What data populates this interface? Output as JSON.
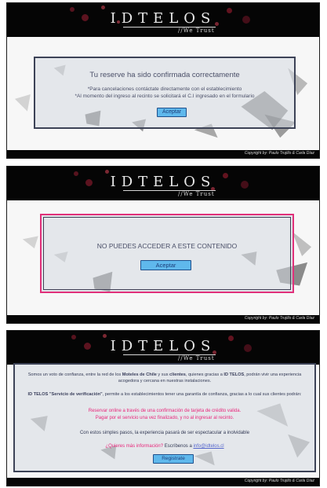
{
  "brand": {
    "logo": "IDTELOS",
    "slogan": "//We Trust"
  },
  "footer": {
    "copyright": "Copyright by: Paulo Trujillo & Carla Díaz"
  },
  "panel1": {
    "title": "Tu reserve ha sido confirmada correctamente",
    "line1": "*Para cancelaciones contáctate directamente con el establecimiento",
    "line2": "*Al momento del ingreso al recinto se solicitará el C.I ingresado en el formulario",
    "button": "Aceptar"
  },
  "panel2": {
    "title": "NO PUEDES ACCEDER A ESTE CONTENIDO",
    "button": "Aceptar"
  },
  "panel3": {
    "p1_a": "Somos un voto de confianza, entre la red de los ",
    "p1_b": "Moteles de Chile",
    "p1_c": " y sus ",
    "p1_d": "clientes",
    "p1_e": ", quienes gracias a ",
    "p1_f": "ID TELOS",
    "p1_g": ", podrán vivir una experiencia",
    "p1_line2": "acogedora y cercana en nuestras instalaciones.",
    "p2_a": "ID TELOS \"Servicio de verificación\"",
    "p2_b": ", permite a los establecimientos tener una garantía de confianza, gracias a lo cual sus clientes podrán:",
    "pink1": "Reservar online a través de una confirmación de tarjeta de crédito valida.",
    "pink2": "Pagar por el servicio una vez finalizado, y no al ingresar al recinto.",
    "p3": "Con estos simples pasos, la experiencia pasará de ser espectacular a inolvidable",
    "q_pink": "¿Quieres más información?",
    "q_text": " Escríbenos a ",
    "q_link": "info@idtelos.cl",
    "button": "Registrate"
  },
  "colors": {
    "accent_pink": "#e0307a",
    "button_blue": "#5fb8ec",
    "header_bg": "#050505"
  }
}
